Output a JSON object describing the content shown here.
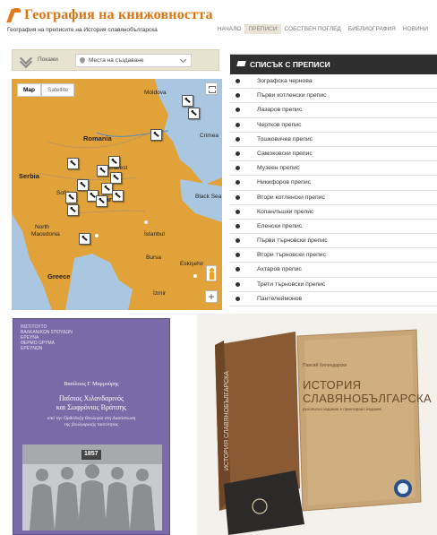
{
  "header": {
    "title": "География на книжовността",
    "subtitle": "География на преписите на История славянобългарска",
    "nav": [
      {
        "label": "НАЧАЛО",
        "active": false
      },
      {
        "label": "ПРЕПИСИ",
        "active": true
      },
      {
        "label": "СОБСТВЕН ПОГЛЕД",
        "active": false
      },
      {
        "label": "БИБЛИОГРАФИЯ",
        "active": false
      },
      {
        "label": "НОВИНИ",
        "active": false
      }
    ]
  },
  "toolbar": {
    "show_label": "Покажи",
    "select_value": "Места на създаване"
  },
  "map": {
    "tab_map": "Map",
    "tab_satellite": "Satellite",
    "zoom_in": "+",
    "labels": {
      "moldova": "Moldova",
      "romania": "Romania",
      "bucharest": "Bucharest",
      "serbia": "Serbia",
      "sofia": "Sofia",
      "bulgaria": "Bulgaria",
      "north": "North",
      "macedonia": "Macedonia",
      "greece": "Greece",
      "istanbul": "İstanbul",
      "izmir": "İzmir",
      "bursa": "Bursa",
      "eskisehir": "Eskişehir",
      "crimea": "Crimea",
      "black_sea": "Black Sea"
    }
  },
  "list": {
    "heading": "СПИСЪК С ПРЕПИСИ",
    "items": [
      "Зографска чернова",
      "Първи котленски препис",
      "Лазаров препис",
      "Чертков препис",
      "Тошковичев препис",
      "Самоковски препис",
      "Музеен препис",
      "Никифоров препис",
      "Втори котленски препис",
      "Копанлъшки препис",
      "Еленски препис",
      "Първи търновски препис",
      "Втори търновски препис",
      "Ахтаров препис",
      "Трети търновски препис",
      "Пантелеймонов"
    ]
  },
  "book1": {
    "top_lines": [
      "ΙΝΣΤΙΤΟΥΤΟ",
      "ΒΑΛΚΑΝΙΚΩΝ ΣΠΟΥΔΩΝ",
      "ΕΡΕΥΝΑ",
      "ΘΕΡΜΟ ΩΡΥΜΑ",
      "ΕΡΕΥΝΩΝ"
    ],
    "author": "Βασίλειος Γ. Μαμμούρης",
    "title_lines": [
      "Παΐσιος Χιλανδαρινός",
      "και Σωφρόνιος Βράτσης"
    ],
    "subtitle_lines": [
      "από την Ορθόδοξη Θεολογία στη Διαπίστωση",
      "της βουλγαρικής ταυτότητας"
    ],
    "badge": "1857"
  },
  "book2": {
    "author": "Паисий Хилендарски",
    "title_lines": [
      "ИСТОРИЯ",
      "СЛАВЯНОБЪЛГАРСКА"
    ],
    "sub": "ръкописно издание в принтирано издание",
    "spine": "ИСТОРИЯ СЛАВЯНОБЪЛГАРСКА"
  },
  "colors": {
    "brand": "#d87515",
    "map_land": "#e2a23a",
    "map_sea": "#a9c7e0",
    "list_head_bg": "#2e2e2e",
    "book1_bg": "#7a6aa8",
    "book2_leather": "#8a5a35"
  }
}
